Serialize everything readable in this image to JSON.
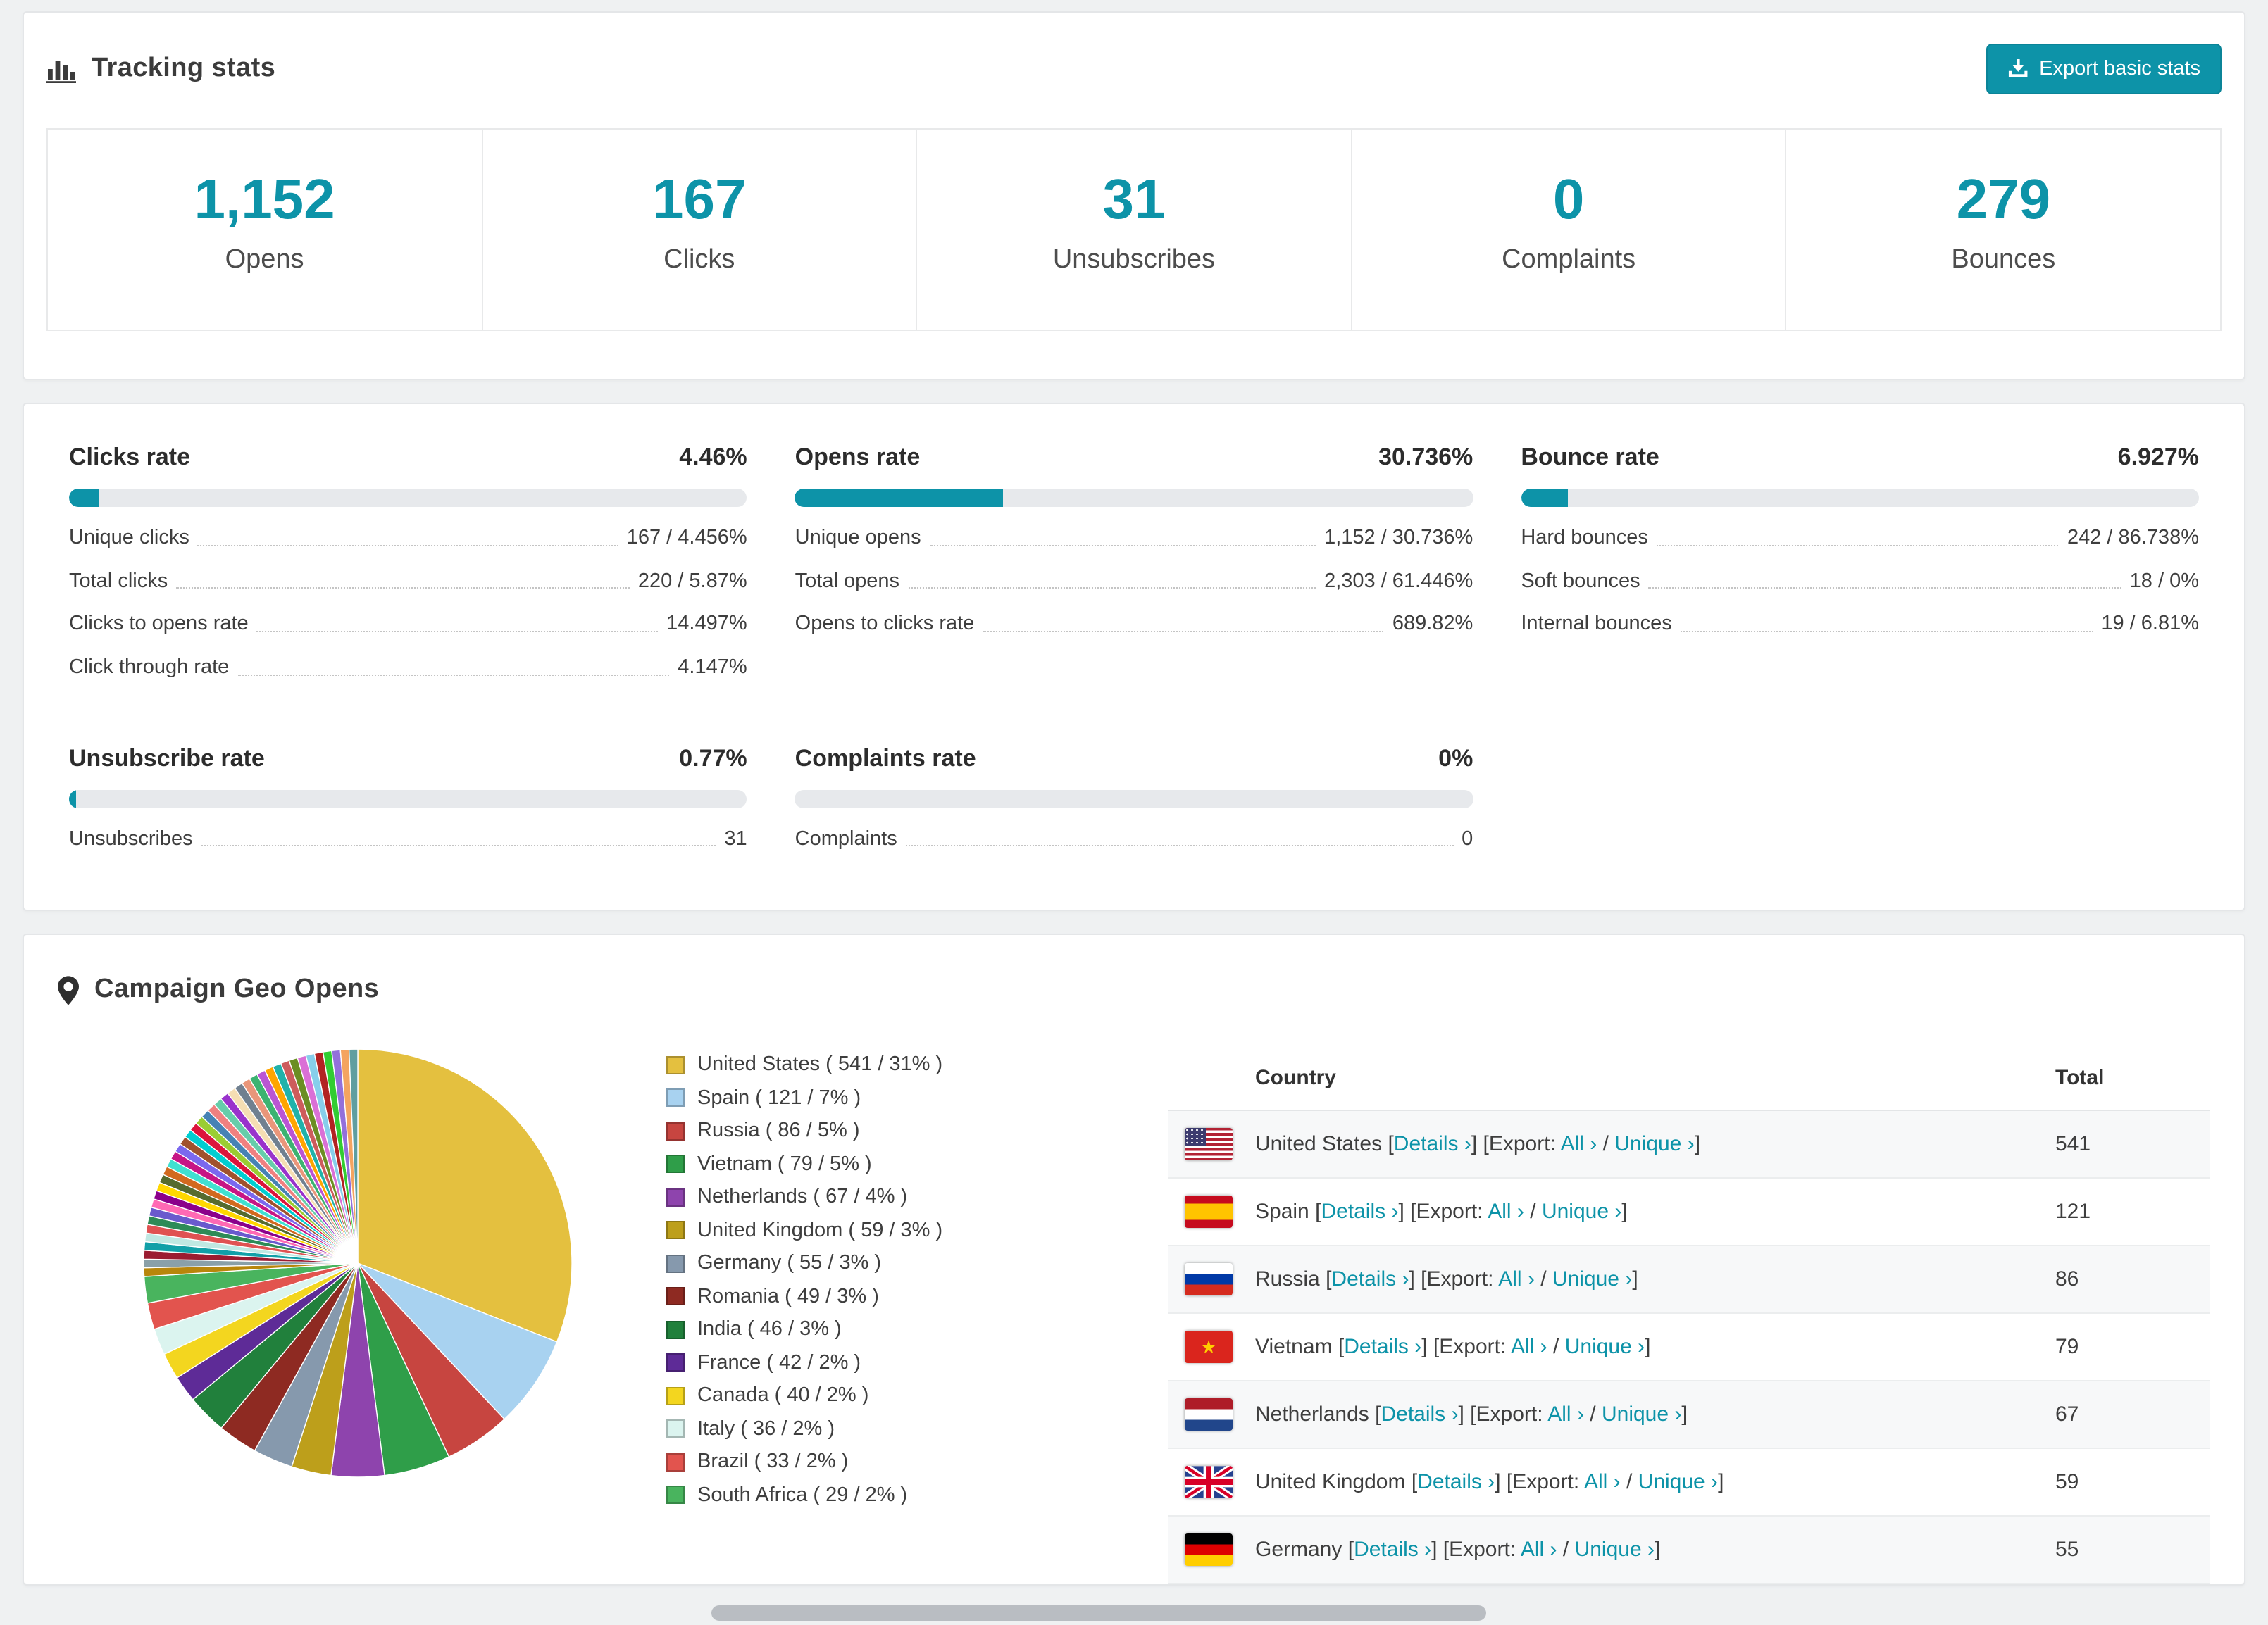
{
  "colors": {
    "accent": "#0d93a8"
  },
  "tracking": {
    "title": "Tracking stats",
    "export_label": "Export basic stats",
    "stats": [
      {
        "value": "1,152",
        "label": "Opens"
      },
      {
        "value": "167",
        "label": "Clicks"
      },
      {
        "value": "31",
        "label": "Unsubscribes"
      },
      {
        "value": "0",
        "label": "Complaints"
      },
      {
        "value": "279",
        "label": "Bounces"
      }
    ]
  },
  "rates": [
    {
      "title": "Clicks rate",
      "value": "4.46%",
      "percent": 4.46,
      "rows": [
        {
          "label": "Unique clicks",
          "value": "167 / 4.456%"
        },
        {
          "label": "Total clicks",
          "value": "220 / 5.87%"
        },
        {
          "label": "Clicks to opens rate",
          "value": "14.497%"
        },
        {
          "label": "Click through rate",
          "value": "4.147%"
        }
      ]
    },
    {
      "title": "Opens rate",
      "value": "30.736%",
      "percent": 30.736,
      "rows": [
        {
          "label": "Unique opens",
          "value": "1,152 / 30.736%"
        },
        {
          "label": "Total opens",
          "value": "2,303 / 61.446%"
        },
        {
          "label": "Opens to clicks rate",
          "value": "689.82%"
        }
      ]
    },
    {
      "title": "Bounce rate",
      "value": "6.927%",
      "percent": 6.927,
      "rows": [
        {
          "label": "Hard bounces",
          "value": "242 / 86.738%"
        },
        {
          "label": "Soft bounces",
          "value": "18 / 0%"
        },
        {
          "label": "Internal bounces",
          "value": "19 / 6.81%"
        }
      ]
    },
    {
      "title": "Unsubscribe rate",
      "value": "0.77%",
      "percent": 0.77,
      "rows": [
        {
          "label": "Unsubscribes",
          "value": "31"
        }
      ]
    },
    {
      "title": "Complaints rate",
      "value": "0%",
      "percent": 0,
      "rows": [
        {
          "label": "Complaints",
          "value": "0"
        }
      ]
    }
  ],
  "geo": {
    "title": "Campaign Geo Opens",
    "table": {
      "country_header": "Country",
      "total_header": "Total",
      "open_bracket": "[",
      "close_bracket": "]",
      "details_label": "Details ›",
      "export_prefix": "[Export:",
      "all_label": "All ›",
      "slash": "/",
      "unique_label": "Unique ›",
      "rows": [
        {
          "country": "United States",
          "flag": "us",
          "total": "541"
        },
        {
          "country": "Spain",
          "flag": "es",
          "total": "121"
        },
        {
          "country": "Russia",
          "flag": "ru",
          "total": "86"
        },
        {
          "country": "Vietnam",
          "flag": "vn",
          "total": "79"
        },
        {
          "country": "Netherlands",
          "flag": "nl",
          "total": "67"
        },
        {
          "country": "United Kingdom",
          "flag": "gb",
          "total": "59"
        },
        {
          "country": "Germany",
          "flag": "de",
          "total": "55"
        }
      ]
    },
    "chart_data": {
      "type": "pie",
      "title": "Campaign Geo Opens",
      "slices": [
        {
          "label": "United States",
          "value": 541,
          "percent": 31,
          "color": "#e4c03f",
          "legend": "United States ( 541 / 31% )"
        },
        {
          "label": "Spain",
          "value": 121,
          "percent": 7,
          "color": "#a8d2f0",
          "legend": "Spain ( 121 / 7% )"
        },
        {
          "label": "Russia",
          "value": 86,
          "percent": 5,
          "color": "#c74540",
          "legend": "Russia ( 86 / 5% )"
        },
        {
          "label": "Vietnam",
          "value": 79,
          "percent": 5,
          "color": "#2f9e49",
          "legend": "Vietnam ( 79 / 5% )"
        },
        {
          "label": "Netherlands",
          "value": 67,
          "percent": 4,
          "color": "#8e44ad",
          "legend": "Netherlands ( 67 / 4% )"
        },
        {
          "label": "United Kingdom",
          "value": 59,
          "percent": 3,
          "color": "#bd9f1b",
          "legend": "United Kingdom ( 59 / 3% )"
        },
        {
          "label": "Germany",
          "value": 55,
          "percent": 3,
          "color": "#8699ad",
          "legend": "Germany ( 55 / 3% )"
        },
        {
          "label": "Romania",
          "value": 49,
          "percent": 3,
          "color": "#8e2a22",
          "legend": "Romania ( 49 / 3% )"
        },
        {
          "label": "India",
          "value": 46,
          "percent": 3,
          "color": "#21803c",
          "legend": "India ( 46 / 3% )"
        },
        {
          "label": "France",
          "value": 42,
          "percent": 2,
          "color": "#5e2b97",
          "legend": "France ( 42 / 2% )"
        },
        {
          "label": "Canada",
          "value": 40,
          "percent": 2,
          "color": "#f3d61f",
          "legend": "Canada ( 40 / 2% )"
        },
        {
          "label": "Italy",
          "value": 36,
          "percent": 2,
          "color": "#dbf4ef",
          "legend": "Italy ( 36 / 2% )"
        },
        {
          "label": "Brazil",
          "value": 33,
          "percent": 2,
          "color": "#e2544e",
          "legend": "Brazil ( 33 / 2% )"
        },
        {
          "label": "South Africa",
          "value": 29,
          "percent": 2,
          "color": "#49b45e",
          "legend": "South Africa ( 29 / 2% )"
        }
      ],
      "others_percent": 26,
      "others_colors": [
        "#b8860b",
        "#8aa0a8",
        "#9b1c31",
        "#11a0a8",
        "#bfe8e2",
        "#e05252",
        "#2e8b57",
        "#6a5acd",
        "#ff69b4",
        "#8b008b",
        "#ffd700",
        "#556b2f",
        "#d2691e",
        "#40e0d0",
        "#c71585",
        "#7b68ee",
        "#a0522d",
        "#00ced1",
        "#dc143c",
        "#9acd32",
        "#4682b4",
        "#f08080",
        "#66cdaa",
        "#9932cc",
        "#f5deb3",
        "#708090",
        "#e9967a",
        "#3cb371",
        "#ba55d3",
        "#ffa500",
        "#20b2aa",
        "#cd5c5c",
        "#6b8e23",
        "#da70d6",
        "#87ceeb",
        "#b22222",
        "#32cd32",
        "#9370db",
        "#f4a460",
        "#5f9ea0"
      ]
    }
  }
}
